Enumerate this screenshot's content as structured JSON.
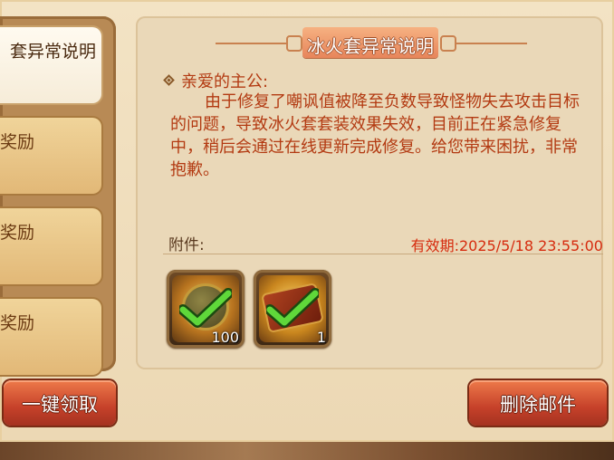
{
  "mail_list": {
    "items": [
      {
        "title": "套异常说明",
        "selected": true
      },
      {
        "title": "奖励",
        "selected": false
      },
      {
        "title": "奖励",
        "selected": false
      },
      {
        "title": "奖励",
        "selected": false
      }
    ]
  },
  "mail": {
    "title": "冰火套异常说明",
    "greeting": "亲爱的主公:",
    "body": "由于修复了嘲讽值被降至负数导致怪物失去攻击目标的问题，导致冰火套套装效果失效，目前正在紧急修复中，稍后会通过在线更新完成修复。给您带来困扰，非常抱歉。",
    "attachments_label": "附件:",
    "expiry": "有效期:2025/5/18 23:55:00",
    "attachments": [
      {
        "icon": "coin-icon",
        "count": "100",
        "claimed": true
      },
      {
        "icon": "book-icon",
        "count": "1",
        "claimed": true
      }
    ]
  },
  "buttons": {
    "claim_all": "一键领取",
    "delete_mail": "删除邮件"
  },
  "colors": {
    "body_text": "#b33a12",
    "expiry_text": "#d62b0e",
    "button": "#c6412a"
  }
}
